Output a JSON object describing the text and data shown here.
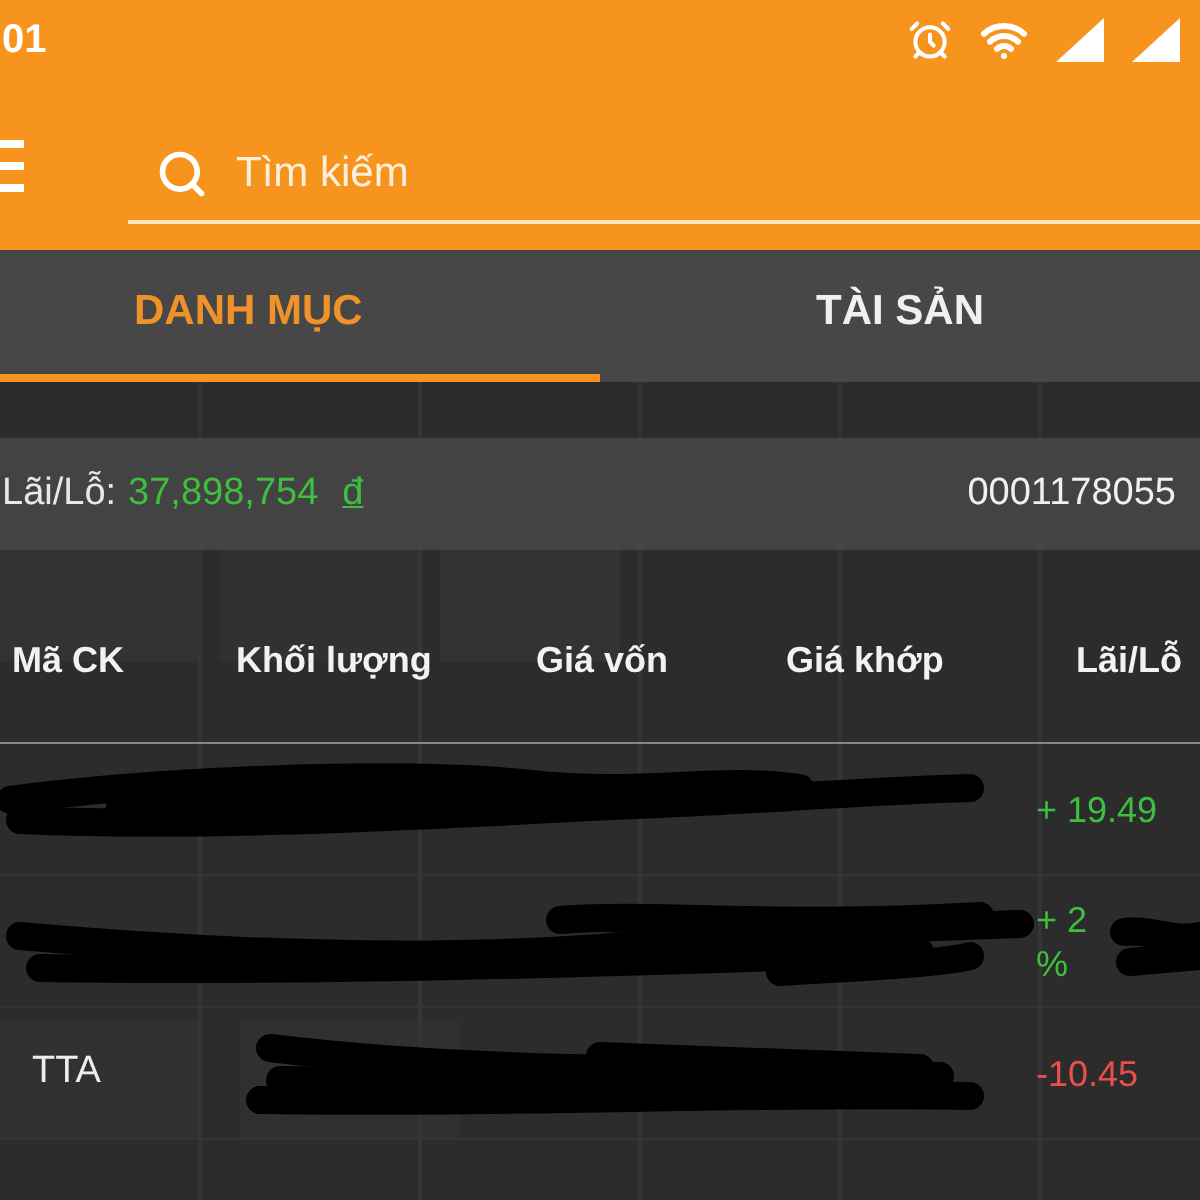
{
  "status_bar": {
    "time": "01"
  },
  "search": {
    "placeholder": "Tìm kiếm"
  },
  "tabs": [
    {
      "label": "DANH MỤC",
      "selected": true
    },
    {
      "label": "TÀI SẢN",
      "selected": false
    }
  ],
  "summary": {
    "label": "Lãi/Lỗ:",
    "amount": "37,898,754",
    "currency": "đ",
    "account": "0001178055"
  },
  "table": {
    "columns": [
      "Mã CK",
      "Khối lượng",
      "Giá vốn",
      "Giá khớp",
      "Lãi/Lỗ"
    ],
    "rows": [
      {
        "profit_loss": [
          "+ 19.49"
        ],
        "color": "#3fbf3f"
      },
      {
        "profit_loss": [
          "+ 2",
          "%"
        ],
        "color": "#3fbf3f"
      },
      {
        "symbol": "TTA",
        "profit_loss": [
          "-10.45"
        ],
        "color": "#e8504a"
      }
    ]
  }
}
